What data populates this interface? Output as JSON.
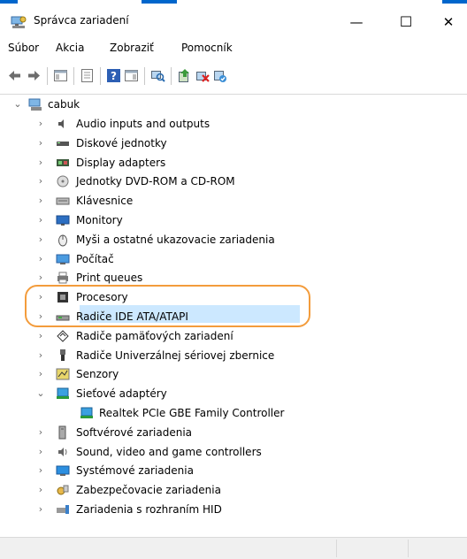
{
  "window": {
    "title": "Správca zariadení"
  },
  "window_controls": {
    "minimize": "—",
    "maximize": "☐",
    "close": "✕"
  },
  "menu": [
    {
      "label": "Súbor"
    },
    {
      "label": "Akcia"
    },
    {
      "label": "Zobraziť"
    },
    {
      "label": "Pomocník"
    }
  ],
  "toolbar": [
    {
      "icon": "back-arrow-icon"
    },
    {
      "icon": "forward-arrow-icon"
    },
    {
      "icon": "show-hide-console-tree-icon"
    },
    {
      "icon": "properties-icon"
    },
    {
      "icon": "help-icon"
    },
    {
      "icon": "show-action-pane-icon"
    },
    {
      "icon": "scan-hardware-changes-icon"
    },
    {
      "icon": "update-driver-icon"
    },
    {
      "icon": "uninstall-device-icon"
    },
    {
      "icon": "enable-device-icon"
    }
  ],
  "tree": {
    "root": {
      "label": "cabuk",
      "expanded": true
    },
    "categories": [
      {
        "label": "Audio inputs and outputs",
        "icon": "speaker-icon"
      },
      {
        "label": "Diskové jednotky",
        "icon": "disk-drive-icon"
      },
      {
        "label": "Display adapters",
        "icon": "display-adapter-icon"
      },
      {
        "label": "Jednotky DVD-ROM a CD-ROM",
        "icon": "dvd-drive-icon"
      },
      {
        "label": "Klávesnice",
        "icon": "keyboard-icon"
      },
      {
        "label": "Monitory",
        "icon": "monitor-icon"
      },
      {
        "label": "Myši a ostatné ukazovacie zariadenia",
        "icon": "mouse-icon"
      },
      {
        "label": "Počítač",
        "icon": "computer-icon"
      },
      {
        "label": "Print queues",
        "icon": "printer-icon"
      },
      {
        "label": "Procesory",
        "icon": "processor-icon"
      },
      {
        "label": "Radiče IDE ATA/ATAPI",
        "icon": "ide-controller-icon"
      },
      {
        "label": "Radiče pamäťových zariadení",
        "icon": "storage-controller-icon"
      },
      {
        "label": "Radiče Univerzálnej sériovej zbernice",
        "icon": "usb-icon"
      },
      {
        "label": "Senzory",
        "icon": "sensor-icon"
      },
      {
        "label": "Sieťové adaptéry",
        "icon": "network-adapter-icon",
        "expanded": true,
        "children": [
          {
            "label": "Realtek PCIe GBE Family Controller",
            "icon": "network-adapter-icon",
            "selected": true
          }
        ]
      },
      {
        "label": "Softvérové zariadenia",
        "icon": "software-device-icon"
      },
      {
        "label": "Sound, video and game controllers",
        "icon": "sound-icon"
      },
      {
        "label": "Systémové zariadenia",
        "icon": "system-device-icon"
      },
      {
        "label": "Zabezpečovacie zariadenia",
        "icon": "security-key-icon"
      },
      {
        "label": "Zariadenia s rozhraním HID",
        "icon": "hid-icon"
      }
    ]
  },
  "colors": {
    "selection": "#cce8ff",
    "highlight_ring": "#f39c3c",
    "top_strip": "#0066cc"
  }
}
